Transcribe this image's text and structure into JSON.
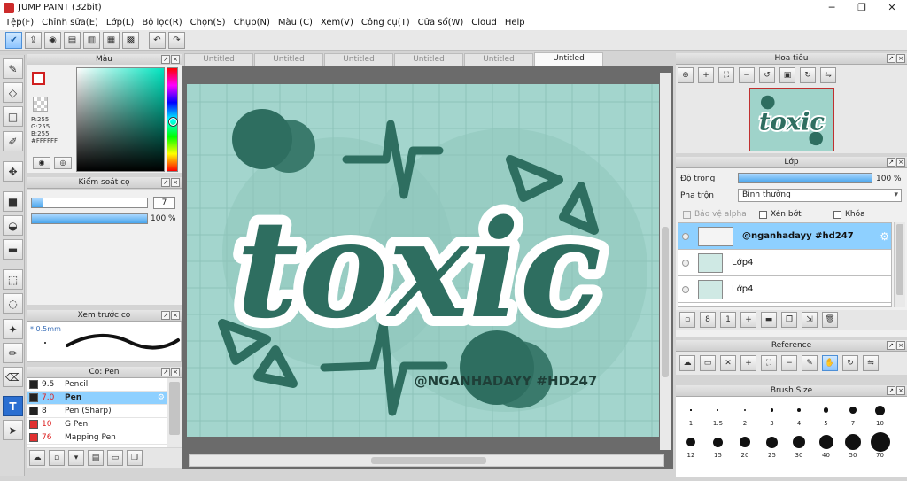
{
  "window": {
    "title": "JUMP PAINT (32bit)",
    "controls": [
      "─",
      "❐",
      "✕"
    ]
  },
  "menu": [
    "Tệp(F)",
    "Chỉnh sửa(E)",
    "Lớp(L)",
    "Bộ lọc(R)",
    "Chọn(S)",
    "Chụp(N)",
    "Màu (C)",
    "Xem(V)",
    "Công cụ(T)",
    "Cửa sổ(W)",
    "Cloud",
    "Help"
  ],
  "tabs": [
    {
      "label": "Untitled",
      "active": false
    },
    {
      "label": "Untitled",
      "active": false
    },
    {
      "label": "Untitled",
      "active": false
    },
    {
      "label": "Untitled",
      "active": false
    },
    {
      "label": "Untitled",
      "active": false
    },
    {
      "label": "Untitled",
      "active": true
    }
  ],
  "color_panel": {
    "title": "Màu",
    "r": "R:255",
    "g": "G:255",
    "b": "B:255",
    "hex": "#FFFFFF"
  },
  "brush_control": {
    "title": "Kiểm soát cọ",
    "size": "7",
    "size_fraction": 0.1,
    "opacity": "100 %",
    "opacity_fraction": 1.0
  },
  "brush_preview": {
    "title": "Xem trước cọ",
    "size_label": "0.5mm"
  },
  "brush_list": {
    "title": "Cọ: Pen",
    "items": [
      {
        "size": "9.5",
        "name": "Pencil",
        "color": "#222222",
        "selected": false
      },
      {
        "size": "7.0",
        "name": "Pen",
        "color": "#222222",
        "selected": true
      },
      {
        "size": "8",
        "name": "Pen (Sharp)",
        "color": "#222222",
        "selected": false
      },
      {
        "size": "10",
        "name": "G Pen",
        "color": "#e03030",
        "selected": false
      },
      {
        "size": "76",
        "name": "Mapping Pen",
        "color": "#e03030",
        "selected": false
      }
    ]
  },
  "navigator": {
    "title": "Hoa tiêu"
  },
  "layers": {
    "title": "Lớp",
    "opacity_label": "Độ trong",
    "opacity_value": "100 %",
    "opacity_fraction": 1.0,
    "blend_label": "Pha trộn",
    "blend_value": "Bình thường",
    "protect_alpha": "Bảo vệ alpha",
    "clipping": "Xén bớt",
    "lock": "Khóa",
    "items": [
      {
        "name": "@nganhadayy #hd247",
        "selected": true
      },
      {
        "name": "Lớp4",
        "selected": false
      },
      {
        "name": "Lớp4",
        "selected": false
      }
    ]
  },
  "reference": {
    "title": "Reference"
  },
  "brush_size": {
    "title": "Brush Size",
    "row1": [
      "1",
      "1.5",
      "2",
      "3",
      "4",
      "5",
      "7",
      "10"
    ],
    "row2": [
      "12",
      "15",
      "20",
      "25",
      "30",
      "40",
      "50",
      "70"
    ]
  },
  "artwork": {
    "main_text": "toxic",
    "signature": "@NGANHADAYY #HD247",
    "bg_color": "#a3d5cd",
    "ink_color": "#2e6e60"
  }
}
